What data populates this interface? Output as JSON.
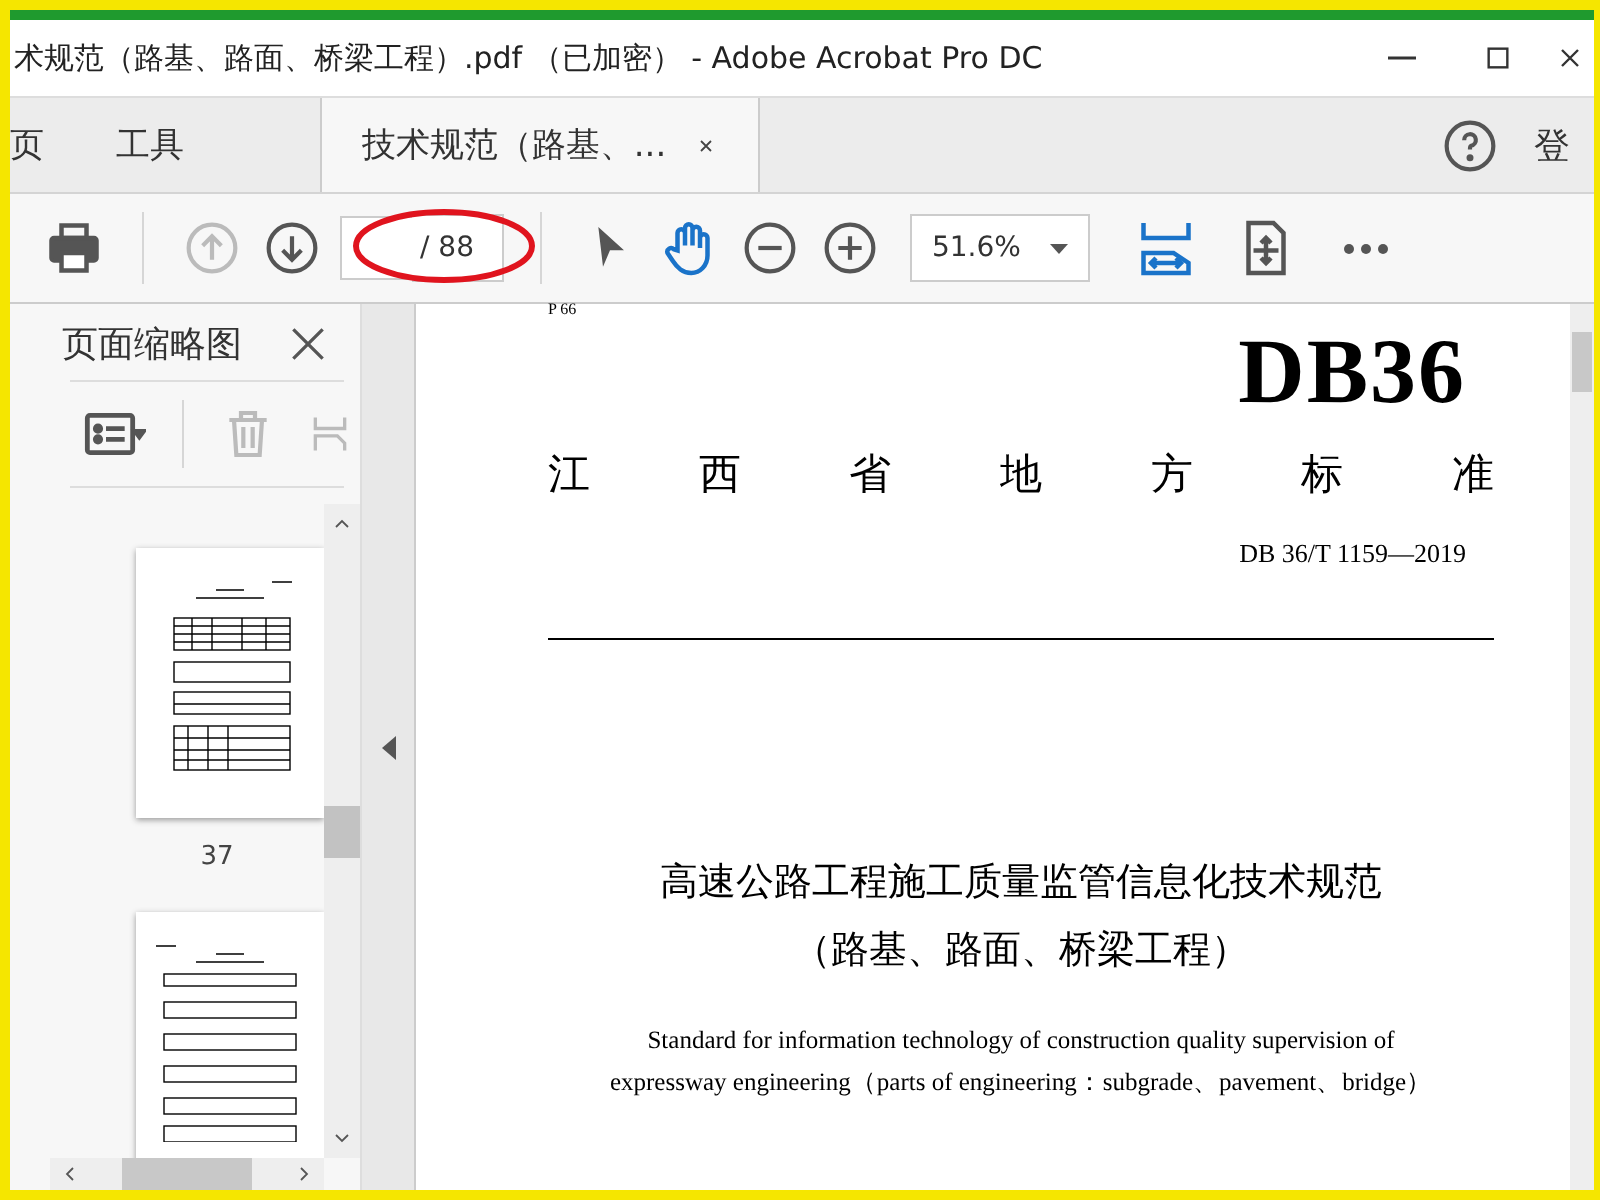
{
  "window": {
    "title": "术规范（路基、路面、桥梁工程）.pdf （已加密） - Adobe Acrobat Pro DC"
  },
  "tabs": [
    {
      "label": "页",
      "selected": false
    },
    {
      "label": "工具",
      "selected": false
    },
    {
      "label": "技术规范（路基、...",
      "selected": true
    }
  ],
  "account": {
    "label": "登"
  },
  "toolbar": {
    "previous_disabled": true,
    "next_disabled": false,
    "page_total": "/ 88",
    "zoom": "51.6%"
  },
  "sidebar": {
    "title": "页面缩略图",
    "thumbnail_labels": [
      "37"
    ]
  },
  "document": {
    "page_mark": "P 66",
    "code": "DB36",
    "issuer": "江 西 省 地 方 标 准",
    "number": "DB 36/T 1159—2019",
    "title_lines": [
      "高速公路工程施工质量监管信息化技术规范",
      "（路基、路面、桥梁工程）"
    ],
    "english": "Standard for information technology of construction quality supervision of expressway engineering（parts of engineering：subgrade、pavement、bridge）"
  }
}
